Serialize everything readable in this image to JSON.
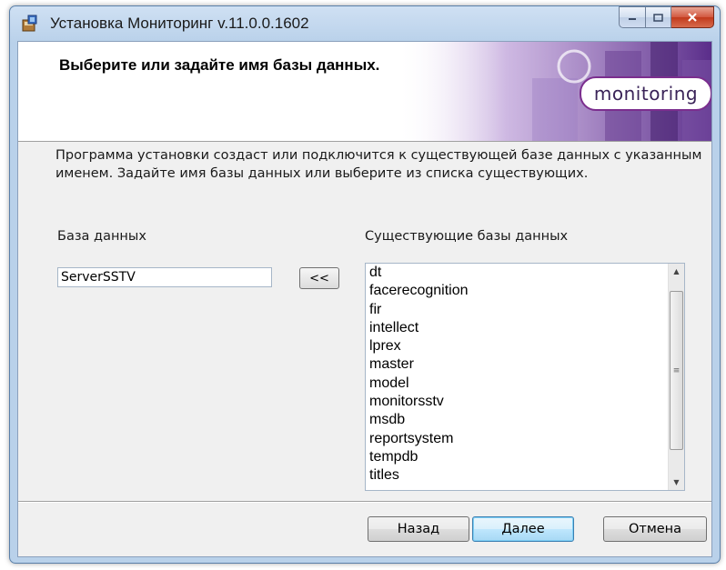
{
  "window": {
    "title": "Установка Мониторинг v.11.0.0.1602"
  },
  "banner": {
    "title": "Выберите или задайте имя базы данных.",
    "logo_text": "monitoring"
  },
  "description": "Программа установки создаст или подключится к существующей базе данных с указанным именем. Задайте имя базы данных или выберите из списка существующих.",
  "database": {
    "label": "База данных",
    "value": "ServerSSTV",
    "copy_button": "<<"
  },
  "existing": {
    "label": "Существующие базы данных",
    "items": [
      "dt",
      "facerecognition",
      "fir",
      "intellect",
      "lprex",
      "master",
      "model",
      "monitorsstv",
      "msdb",
      "reportsystem",
      "tempdb",
      "titles"
    ]
  },
  "buttons": {
    "back": "Назад",
    "next": "Далее",
    "cancel": "Отмена"
  },
  "colors": {
    "accent": "#7b2e8e",
    "title_close": "#c13a1c",
    "default_button": "#3c7fb1"
  }
}
